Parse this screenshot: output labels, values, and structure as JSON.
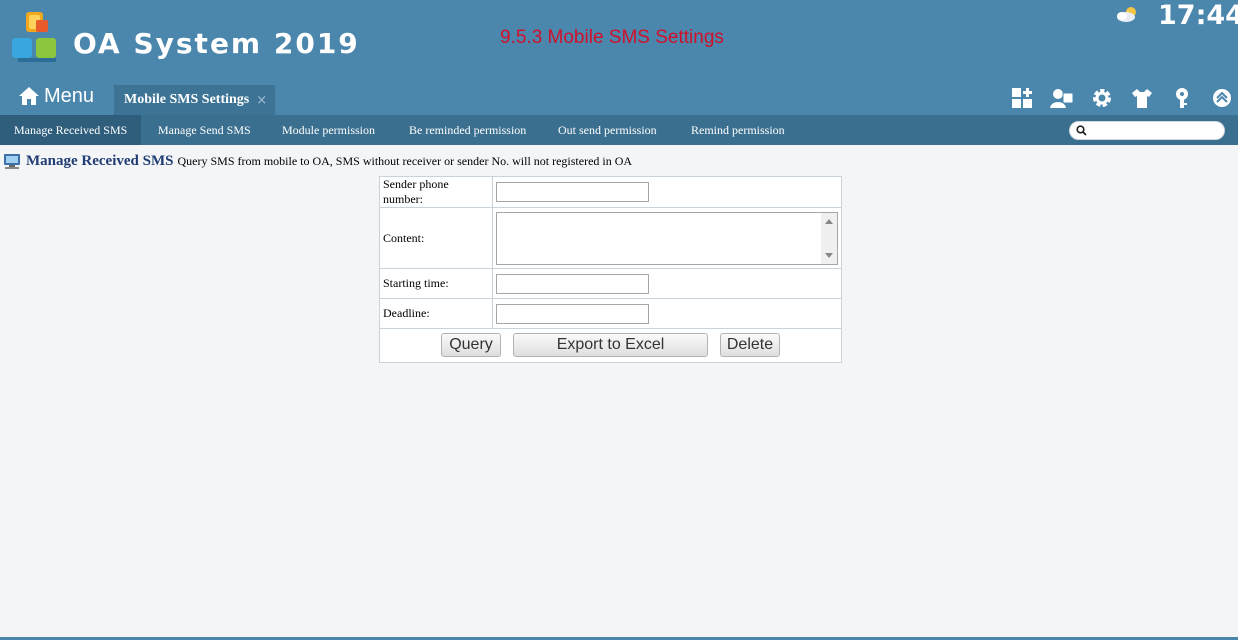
{
  "header": {
    "app_title": "OA System 2019",
    "page_heading": "9.5.3 Mobile SMS Settings",
    "clock": "17:44",
    "weather_icon": "partly-cloudy-icon",
    "menu_label": "Menu",
    "active_tab": {
      "label": "Mobile SMS Settings",
      "close": "×"
    },
    "tools": [
      "grid-add-icon",
      "user-puzzle-icon",
      "gear-icon",
      "shirt-icon",
      "key-icon",
      "chevron-up-icon"
    ]
  },
  "subnav": {
    "items": [
      "Manage Received SMS",
      "Manage Send SMS",
      "Module permission",
      "Be reminded permission",
      "Out send permission",
      "Remind permission"
    ],
    "search_placeholder": ""
  },
  "content": {
    "title": "Manage Received SMS",
    "description": "Query SMS from mobile to OA, SMS without receiver or sender No. will not registered in OA",
    "form": {
      "sender_label": "Sender phone number:",
      "sender_value": "",
      "content_label": "Content:",
      "content_value": "",
      "start_label": "Starting time:",
      "start_value": "",
      "deadline_label": "Deadline:",
      "deadline_value": ""
    },
    "buttons": {
      "query": "Query",
      "export": "Export to Excel",
      "delete": "Delete"
    }
  },
  "colors": {
    "header_bg": "#4b87ad",
    "subnav_bg": "#3b6f8f",
    "heading_red": "#d0102a",
    "title_blue": "#1f3d73"
  }
}
